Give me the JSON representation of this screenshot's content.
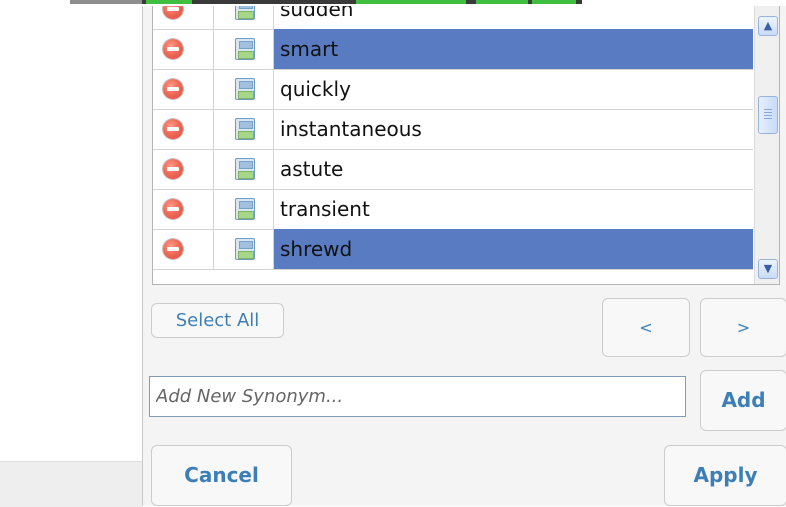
{
  "synonyms": [
    {
      "text": "sudden",
      "selected": false
    },
    {
      "text": "smart",
      "selected": true
    },
    {
      "text": "quickly",
      "selected": false
    },
    {
      "text": "instantaneous",
      "selected": false
    },
    {
      "text": "astute",
      "selected": false
    },
    {
      "text": "transient",
      "selected": false
    },
    {
      "text": "shrewd",
      "selected": true
    }
  ],
  "controls": {
    "select_all_label": "Select All",
    "prev_label": "<",
    "next_label": ">",
    "add_label": "Add",
    "cancel_label": "Cancel",
    "apply_label": "Apply"
  },
  "input": {
    "placeholder": "Add New Synonym...",
    "value": ""
  },
  "icons": {
    "delete": "remove-circle-icon",
    "save": "floppy-disk-icon",
    "scroll_up": "chevron-up-icon",
    "scroll_down": "chevron-down-icon"
  },
  "colors": {
    "selection": "#587bc2",
    "link_text": "#3d7fb5",
    "delete_icon": "#f06a58"
  }
}
